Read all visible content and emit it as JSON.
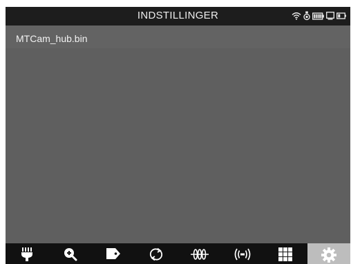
{
  "header": {
    "title": "INDSTILLINGER",
    "status_icons": [
      "wifi-icon",
      "camera-connected-icon",
      "battery-icon",
      "display-icon",
      "camera-battery-icon"
    ]
  },
  "file": {
    "name": "MTCam_hub.bin"
  },
  "toolbar": {
    "items": [
      {
        "name": "illumination-icon",
        "active": false
      },
      {
        "name": "zoom-in-icon",
        "active": false
      },
      {
        "name": "tag-icon",
        "active": false
      },
      {
        "name": "rotate-icon",
        "active": false
      },
      {
        "name": "tube-loops-icon",
        "active": false
      },
      {
        "name": "signal-icon",
        "active": false
      },
      {
        "name": "grid-icon",
        "active": false
      },
      {
        "name": "settings-gear-icon",
        "active": true
      }
    ]
  },
  "colors": {
    "topbar": "#1d1d1d",
    "content": "#5f5f5f",
    "toolbar": "#111111",
    "active_tool": "#bdbdbd",
    "text": "#eeeeee"
  }
}
